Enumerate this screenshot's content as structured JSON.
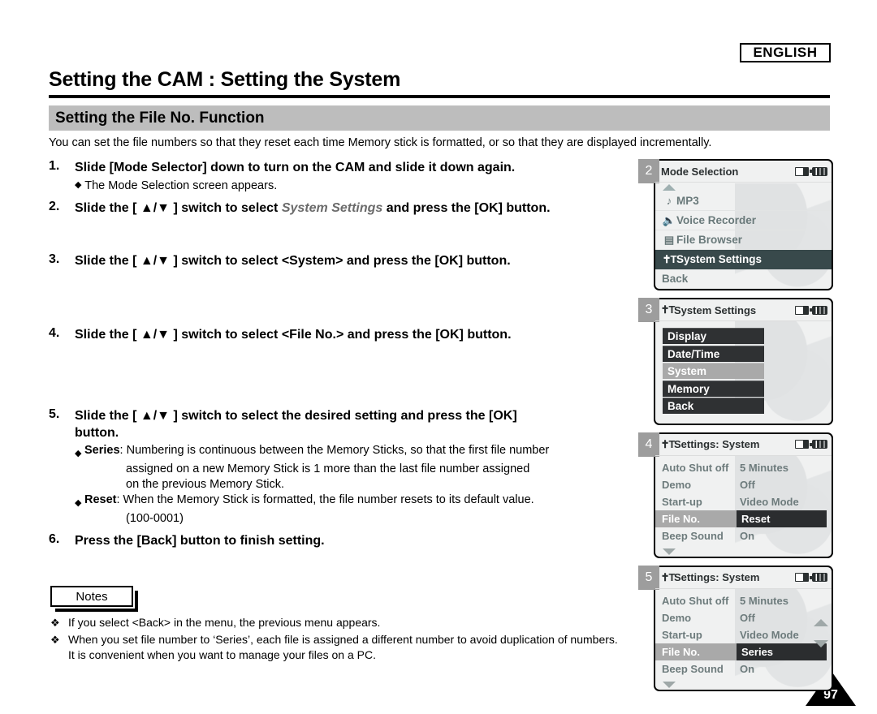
{
  "language_badge": "ENGLISH",
  "page_title": "Setting the CAM : Setting the System",
  "section_title": "Setting the File No. Function",
  "intro": "You can set the file numbers so that they reset each time Memory stick is formatted, or so that they are displayed incrementally.",
  "page_number": "97",
  "steps": [
    {
      "num": "1.",
      "text": "Slide [Mode Selector] down to turn on the CAM and slide it down again.",
      "sub": "The Mode Selection screen appears."
    },
    {
      "num": "2.",
      "text_before": "Slide the [ ▲/▼ ] switch to select ",
      "emphasis": "System Settings",
      "text_after": " and press the [OK] button."
    },
    {
      "num": "3.",
      "text": "Slide the [ ▲/▼ ] switch to select <System> and press the [OK] button."
    },
    {
      "num": "4.",
      "text": "Slide the [ ▲/▼ ] switch to select <File No.> and press the [OK] button."
    },
    {
      "num": "5.",
      "text": "Slide the [ ▲/▼ ] switch to select the desired setting and press the [OK] button."
    },
    {
      "num": "6.",
      "text": "Press the [Back] button to finish setting."
    }
  ],
  "definitions": [
    {
      "mark": "◆",
      "term": "Series",
      "body": ": Numbering is continuous between the Memory Sticks, so that the first file number",
      "cont": [
        "assigned on a new Memory Stick is 1 more than the last file number assigned",
        "on the previous Memory Stick."
      ]
    },
    {
      "mark": "◆",
      "term": "Reset",
      "body": ": When the Memory Stick is formatted, the file number resets to its default value.",
      "cont": [
        "(100-0001)"
      ]
    }
  ],
  "notes": {
    "label": "Notes",
    "mark": "❖",
    "items": [
      "If you select <Back> in the menu, the previous menu appears.",
      "When you set file number to ‘Series’, each file is assigned a different number to avoid duplication of numbers. It is convenient when you want to manage your files on a PC."
    ]
  },
  "colors": {
    "section_bar": "#bdbdbd",
    "badge_gray": "#9d9d9d",
    "lcd_bg": "#f0f1f1",
    "lcd_selected_dark": "#38494b",
    "lcd_label_gray": "#6d7b7c",
    "lcd_button_dark": "#2f3133",
    "lcd_button_selected": "#a9a9a9"
  },
  "screens": [
    {
      "badge": "2",
      "title": "Mode Selection",
      "status_icons": [
        "memory-card-icon",
        "battery-icon"
      ],
      "scroll_up": true,
      "items": [
        {
          "icon": "music-note-icon",
          "label": "MP3",
          "selected": false
        },
        {
          "icon": "microphone-icon",
          "label": "Voice Recorder",
          "selected": false
        },
        {
          "icon": "document-icon",
          "label": "File Browser",
          "selected": false
        },
        {
          "icon": "tools-icon",
          "label": "System Settings",
          "selected": true
        },
        {
          "icon": null,
          "label": "Back",
          "selected": false
        }
      ]
    },
    {
      "badge": "3",
      "title": "System Settings",
      "title_icon": "tools-icon",
      "status_icons": [
        "memory-card-icon",
        "battery-icon"
      ],
      "buttons": [
        {
          "label": "Display",
          "selected": false
        },
        {
          "label": "Date/Time",
          "selected": false
        },
        {
          "label": "System",
          "selected": true
        },
        {
          "label": "Memory",
          "selected": false
        },
        {
          "label": "Back",
          "selected": false
        }
      ]
    },
    {
      "badge": "4",
      "title": "Settings: System",
      "title_icon": "tools-icon",
      "status_icons": [
        "memory-card-icon",
        "battery-icon"
      ],
      "rows": [
        {
          "label": "Auto Shut off",
          "value": "5 Minutes",
          "selected": false
        },
        {
          "label": "Demo",
          "value": "Off",
          "selected": false
        },
        {
          "label": "Start-up",
          "value": "Video Mode",
          "selected": false
        },
        {
          "label": "File No.",
          "value": "Reset",
          "selected": true
        },
        {
          "label": "Beep Sound",
          "value": "On",
          "selected": false
        }
      ],
      "scroll_down": true,
      "side_arrows": false
    },
    {
      "badge": "5",
      "title": "Settings: System",
      "title_icon": "tools-icon",
      "status_icons": [
        "memory-card-icon",
        "battery-icon"
      ],
      "rows": [
        {
          "label": "Auto Shut off",
          "value": "5 Minutes",
          "selected": false
        },
        {
          "label": "Demo",
          "value": "Off",
          "selected": false
        },
        {
          "label": "Start-up",
          "value": "Video Mode",
          "selected": false
        },
        {
          "label": "File No.",
          "value": "Series",
          "selected": true
        },
        {
          "label": "Beep Sound",
          "value": "On",
          "selected": false
        }
      ],
      "scroll_down": true,
      "side_arrows": true
    }
  ]
}
